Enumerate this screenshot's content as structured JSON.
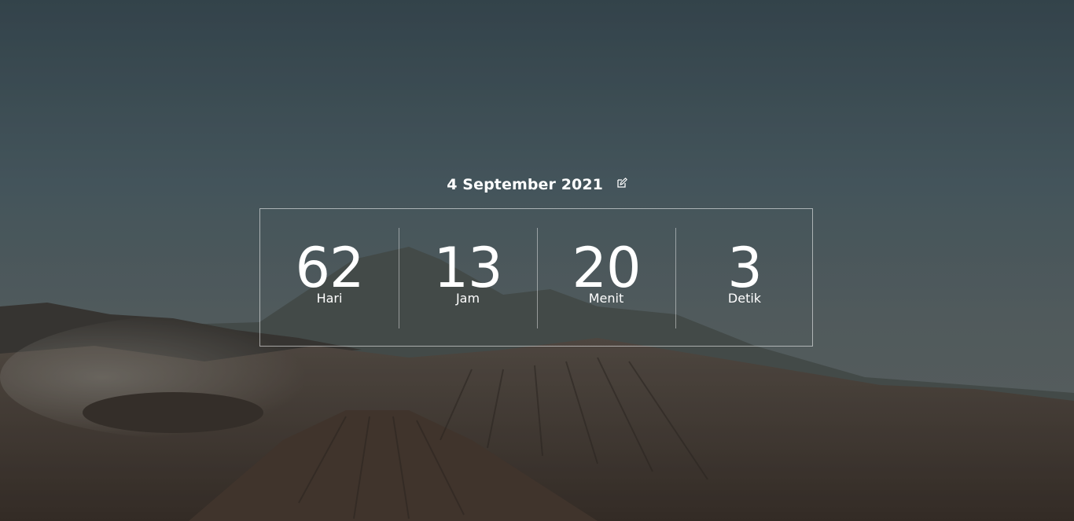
{
  "header": {
    "date_label": "4 September 2021",
    "edit_icon": "edit-icon"
  },
  "countdown": {
    "days": {
      "value": "62",
      "label": "Hari"
    },
    "hours": {
      "value": "13",
      "label": "Jam"
    },
    "minutes": {
      "value": "20",
      "label": "Menit"
    },
    "seconds": {
      "value": "3",
      "label": "Detik"
    }
  },
  "colors": {
    "text": "#ffffff",
    "border": "#ffffff"
  }
}
